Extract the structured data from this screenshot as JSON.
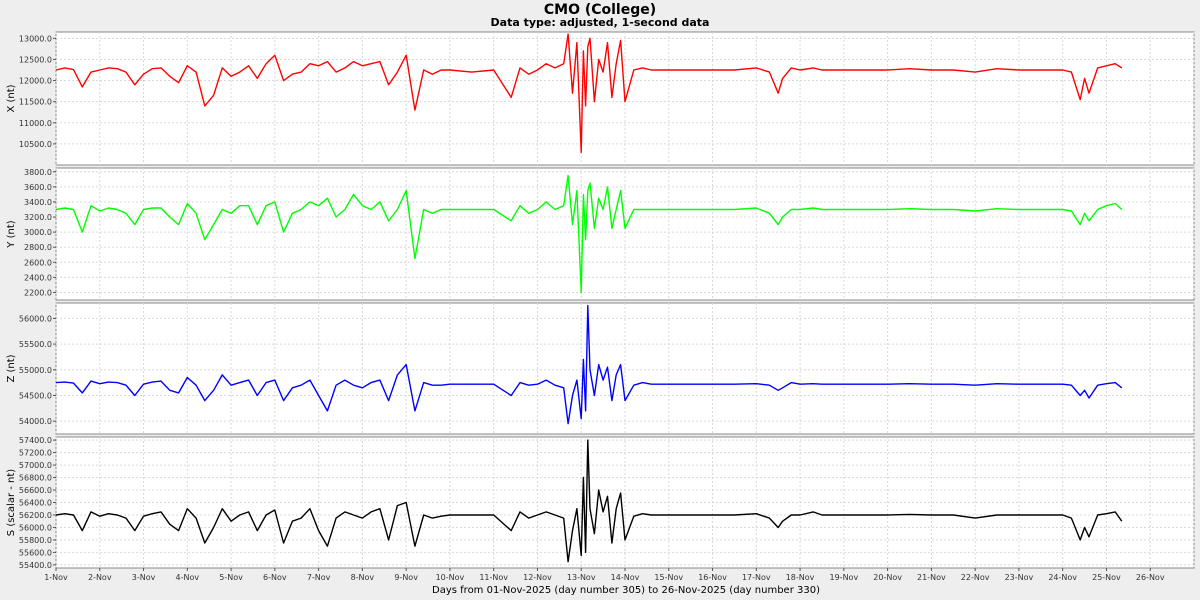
{
  "title": "CMO (College)",
  "subtitle": "Data type: adjusted, 1-second data",
  "xlabel": "Days from 01-Nov-2025 (day number 305) to 26-Nov-2025 (day number 330)",
  "x_ticks": [
    "1-Nov",
    "2-Nov",
    "3-Nov",
    "4-Nov",
    "5-Nov",
    "6-Nov",
    "7-Nov",
    "8-Nov",
    "9-Nov",
    "10-Nov",
    "11-Nov",
    "12-Nov",
    "13-Nov",
    "14-Nov",
    "15-Nov",
    "16-Nov",
    "17-Nov",
    "18-Nov",
    "19-Nov",
    "20-Nov",
    "21-Nov",
    "22-Nov",
    "23-Nov",
    "24-Nov",
    "25-Nov",
    "26-Nov"
  ],
  "chart_data": [
    {
      "type": "line",
      "ylabel": "X (nt)",
      "color": "#ff0000",
      "ylim": [
        10000,
        13150
      ],
      "y_ticks": [
        "10500.0",
        "11000.0",
        "11500.0",
        "12000.0",
        "12500.0",
        "13000.0"
      ],
      "series": [
        {
          "x": [
            0,
            0.2,
            0.4,
            0.6,
            0.8,
            1.0,
            1.2,
            1.4,
            1.6,
            1.8,
            2.0,
            2.2,
            2.4,
            2.6,
            2.8,
            3.0,
            3.2,
            3.4,
            3.6,
            3.8,
            4.0,
            4.2,
            4.4,
            4.6,
            4.8,
            5.0,
            5.2,
            5.4,
            5.6,
            5.8,
            6.0,
            6.2,
            6.4,
            6.6,
            6.8,
            7.0,
            7.2,
            7.4,
            7.6,
            7.8,
            8.0,
            8.2,
            8.4,
            8.6,
            8.8,
            9.0,
            9.5,
            10.0,
            10.4,
            10.6,
            10.8,
            11.0,
            11.2,
            11.4,
            11.6,
            11.7,
            11.8,
            11.9,
            12.0,
            12.05,
            12.1,
            12.15,
            12.2,
            12.3,
            12.4,
            12.5,
            12.6,
            12.7,
            12.8,
            12.9,
            13.0,
            13.2,
            13.4,
            13.6,
            13.8,
            14.0,
            14.5,
            15.0,
            15.5,
            16.0,
            16.3,
            16.5,
            16.6,
            16.8,
            17.0,
            17.3,
            17.5,
            18.0,
            18.5,
            19.0,
            19.5,
            20.0,
            20.5,
            21.0,
            21.5,
            22.0,
            22.5,
            23.0,
            23.2,
            23.4,
            23.5,
            23.6,
            23.8,
            24.0,
            24.2,
            24.35
          ],
          "y": [
            12250,
            12300,
            12260,
            11850,
            12200,
            12250,
            12300,
            12280,
            12200,
            11900,
            12150,
            12280,
            12300,
            12100,
            11950,
            12350,
            12200,
            11400,
            11650,
            12300,
            12100,
            12200,
            12350,
            12050,
            12400,
            12600,
            12000,
            12150,
            12200,
            12400,
            12350,
            12450,
            12200,
            12300,
            12450,
            12350,
            12400,
            12450,
            11900,
            12200,
            12600,
            11300,
            12250,
            12150,
            12250,
            12250,
            12200,
            12250,
            11600,
            12300,
            12150,
            12250,
            12400,
            12300,
            12400,
            13100,
            11700,
            12900,
            10300,
            12700,
            11400,
            12800,
            13000,
            11500,
            12500,
            12200,
            12900,
            11600,
            12400,
            12950,
            11500,
            12250,
            12300,
            12250,
            12250,
            12250,
            12250,
            12250,
            12250,
            12300,
            12200,
            11700,
            12050,
            12300,
            12250,
            12300,
            12250,
            12250,
            12250,
            12250,
            12280,
            12250,
            12250,
            12200,
            12280,
            12250,
            12250,
            12250,
            12200,
            11550,
            12050,
            11700,
            12300,
            12350,
            12400,
            12300
          ]
        }
      ]
    },
    {
      "type": "line",
      "ylabel": "Y (nt)",
      "color": "#00ff00",
      "ylim": [
        2100,
        3850
      ],
      "y_ticks": [
        "2200.0",
        "2400.0",
        "2600.0",
        "2800.0",
        "3000.0",
        "3200.0",
        "3400.0",
        "3600.0",
        "3800.0"
      ],
      "series": [
        {
          "x": [
            0,
            0.2,
            0.4,
            0.6,
            0.8,
            1.0,
            1.2,
            1.4,
            1.6,
            1.8,
            2.0,
            2.2,
            2.4,
            2.6,
            2.8,
            3.0,
            3.2,
            3.4,
            3.6,
            3.8,
            4.0,
            4.2,
            4.4,
            4.6,
            4.8,
            5.0,
            5.2,
            5.4,
            5.6,
            5.8,
            6.0,
            6.2,
            6.4,
            6.6,
            6.8,
            7.0,
            7.2,
            7.4,
            7.6,
            7.8,
            8.0,
            8.2,
            8.4,
            8.6,
            8.8,
            9.0,
            9.5,
            10.0,
            10.4,
            10.6,
            10.8,
            11.0,
            11.2,
            11.4,
            11.6,
            11.7,
            11.8,
            11.9,
            12.0,
            12.05,
            12.1,
            12.15,
            12.2,
            12.3,
            12.4,
            12.5,
            12.6,
            12.7,
            12.8,
            12.9,
            13.0,
            13.2,
            13.4,
            13.6,
            13.8,
            14.0,
            14.5,
            15.0,
            15.5,
            16.0,
            16.3,
            16.5,
            16.6,
            16.8,
            17.0,
            17.3,
            17.5,
            18.0,
            18.5,
            19.0,
            19.5,
            20.0,
            20.5,
            21.0,
            21.5,
            22.0,
            22.5,
            23.0,
            23.2,
            23.4,
            23.5,
            23.6,
            23.8,
            24.0,
            24.2,
            24.35
          ],
          "y": [
            3300,
            3320,
            3300,
            3000,
            3350,
            3280,
            3320,
            3300,
            3250,
            3100,
            3300,
            3320,
            3320,
            3200,
            3100,
            3380,
            3250,
            2900,
            3100,
            3300,
            3250,
            3350,
            3350,
            3100,
            3350,
            3400,
            3000,
            3250,
            3300,
            3400,
            3350,
            3450,
            3200,
            3300,
            3500,
            3350,
            3300,
            3400,
            3150,
            3300,
            3550,
            2650,
            3300,
            3250,
            3300,
            3300,
            3300,
            3300,
            3150,
            3350,
            3250,
            3300,
            3400,
            3300,
            3350,
            3750,
            3100,
            3550,
            2200,
            3500,
            2900,
            3550,
            3650,
            3050,
            3450,
            3300,
            3600,
            3050,
            3300,
            3550,
            3050,
            3300,
            3300,
            3300,
            3300,
            3300,
            3300,
            3300,
            3300,
            3320,
            3250,
            3100,
            3200,
            3300,
            3300,
            3320,
            3300,
            3300,
            3300,
            3300,
            3310,
            3300,
            3300,
            3280,
            3310,
            3300,
            3300,
            3300,
            3280,
            3100,
            3250,
            3150,
            3300,
            3350,
            3380,
            3300
          ]
        }
      ]
    },
    {
      "type": "line",
      "ylabel": "Z (nt)",
      "color": "#0000ff",
      "ylim": [
        53750,
        56300
      ],
      "y_ticks": [
        "54000.0",
        "54500.0",
        "55000.0",
        "55500.0",
        "56000.0"
      ],
      "series": [
        {
          "x": [
            0,
            0.2,
            0.4,
            0.6,
            0.8,
            1.0,
            1.2,
            1.4,
            1.6,
            1.8,
            2.0,
            2.2,
            2.4,
            2.6,
            2.8,
            3.0,
            3.2,
            3.4,
            3.6,
            3.8,
            4.0,
            4.2,
            4.4,
            4.6,
            4.8,
            5.0,
            5.2,
            5.4,
            5.6,
            5.8,
            6.0,
            6.2,
            6.4,
            6.6,
            6.8,
            7.0,
            7.2,
            7.4,
            7.6,
            7.8,
            8.0,
            8.2,
            8.4,
            8.6,
            8.8,
            9.0,
            9.5,
            10.0,
            10.4,
            10.6,
            10.8,
            11.0,
            11.2,
            11.4,
            11.6,
            11.7,
            11.8,
            11.9,
            12.0,
            12.05,
            12.1,
            12.15,
            12.2,
            12.3,
            12.4,
            12.5,
            12.6,
            12.7,
            12.8,
            12.9,
            13.0,
            13.2,
            13.4,
            13.6,
            13.8,
            14.0,
            14.5,
            15.0,
            15.5,
            16.0,
            16.3,
            16.5,
            16.6,
            16.8,
            17.0,
            17.3,
            17.5,
            18.0,
            18.5,
            19.0,
            19.5,
            20.0,
            20.5,
            21.0,
            21.5,
            22.0,
            22.5,
            23.0,
            23.2,
            23.4,
            23.5,
            23.6,
            23.8,
            24.0,
            24.2,
            24.35
          ],
          "y": [
            54750,
            54760,
            54740,
            54550,
            54780,
            54730,
            54760,
            54750,
            54700,
            54500,
            54720,
            54760,
            54780,
            54600,
            54550,
            54850,
            54700,
            54400,
            54600,
            54900,
            54700,
            54750,
            54800,
            54500,
            54750,
            54800,
            54400,
            54650,
            54700,
            54800,
            54500,
            54200,
            54700,
            54800,
            54700,
            54650,
            54750,
            54800,
            54400,
            54900,
            55100,
            54200,
            54750,
            54700,
            54700,
            54720,
            54720,
            54720,
            54500,
            54750,
            54700,
            54720,
            54800,
            54700,
            54650,
            53950,
            54500,
            54800,
            54050,
            55200,
            54200,
            56250,
            55000,
            54500,
            55100,
            54800,
            55050,
            54400,
            54900,
            55100,
            54400,
            54700,
            54750,
            54720,
            54720,
            54720,
            54720,
            54720,
            54720,
            54730,
            54700,
            54600,
            54650,
            54750,
            54720,
            54730,
            54720,
            54720,
            54720,
            54720,
            54730,
            54720,
            54720,
            54700,
            54730,
            54720,
            54720,
            54720,
            54700,
            54500,
            54600,
            54450,
            54700,
            54730,
            54750,
            54650
          ]
        }
      ]
    },
    {
      "type": "line",
      "ylabel": "S (scalar - nt)",
      "color": "#000000",
      "ylim": [
        55350,
        57450
      ],
      "y_ticks": [
        "55400.0",
        "55600.0",
        "55800.0",
        "56000.0",
        "56200.0",
        "56400.0",
        "56600.0",
        "56800.0",
        "57000.0",
        "57200.0",
        "57400.0"
      ],
      "series": [
        {
          "x": [
            0,
            0.2,
            0.4,
            0.6,
            0.8,
            1.0,
            1.2,
            1.4,
            1.6,
            1.8,
            2.0,
            2.2,
            2.4,
            2.6,
            2.8,
            3.0,
            3.2,
            3.4,
            3.6,
            3.8,
            4.0,
            4.2,
            4.4,
            4.6,
            4.8,
            5.0,
            5.2,
            5.4,
            5.6,
            5.8,
            6.0,
            6.2,
            6.4,
            6.6,
            6.8,
            7.0,
            7.2,
            7.4,
            7.6,
            7.8,
            8.0,
            8.2,
            8.4,
            8.6,
            8.8,
            9.0,
            9.5,
            10.0,
            10.4,
            10.6,
            10.8,
            11.0,
            11.2,
            11.4,
            11.6,
            11.7,
            11.8,
            11.9,
            12.0,
            12.05,
            12.1,
            12.15,
            12.2,
            12.3,
            12.4,
            12.5,
            12.6,
            12.7,
            12.8,
            12.9,
            13.0,
            13.2,
            13.4,
            13.6,
            13.8,
            14.0,
            14.5,
            15.0,
            15.5,
            16.0,
            16.3,
            16.5,
            16.6,
            16.8,
            17.0,
            17.3,
            17.5,
            18.0,
            18.5,
            19.0,
            19.5,
            20.0,
            20.5,
            21.0,
            21.5,
            22.0,
            22.5,
            23.0,
            23.2,
            23.4,
            23.5,
            23.6,
            23.8,
            24.0,
            24.2,
            24.35
          ],
          "y": [
            56200,
            56220,
            56200,
            55950,
            56250,
            56180,
            56220,
            56200,
            56150,
            55950,
            56180,
            56220,
            56250,
            56050,
            55950,
            56300,
            56150,
            55750,
            56000,
            56300,
            56100,
            56200,
            56250,
            55950,
            56200,
            56280,
            55750,
            56100,
            56150,
            56300,
            55950,
            55700,
            56150,
            56250,
            56200,
            56150,
            56250,
            56300,
            55800,
            56350,
            56400,
            55700,
            56200,
            56150,
            56180,
            56200,
            56200,
            56200,
            55950,
            56250,
            56150,
            56200,
            56250,
            56200,
            56150,
            55450,
            55950,
            56300,
            55550,
            56800,
            55600,
            57400,
            56300,
            55900,
            56600,
            56250,
            56500,
            55750,
            56300,
            56550,
            55800,
            56180,
            56220,
            56200,
            56200,
            56200,
            56200,
            56200,
            56200,
            56220,
            56150,
            56000,
            56100,
            56200,
            56200,
            56250,
            56200,
            56200,
            56200,
            56200,
            56210,
            56200,
            56200,
            56150,
            56200,
            56200,
            56200,
            56200,
            56150,
            55800,
            56000,
            55850,
            56200,
            56220,
            56250,
            56100
          ]
        }
      ]
    }
  ]
}
